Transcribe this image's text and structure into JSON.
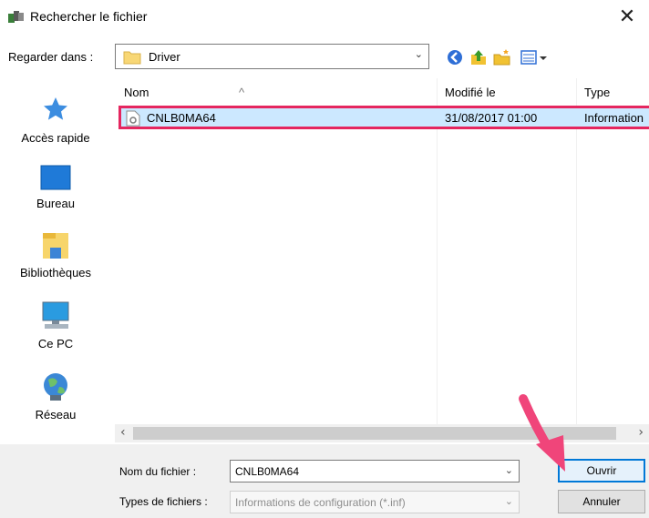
{
  "window": {
    "title": "Rechercher le fichier",
    "close_glyph": "✕"
  },
  "toolbar": {
    "look_in_label": "Regarder dans :",
    "look_in_value": "Driver",
    "buttons": [
      "back-icon",
      "up-folder-icon",
      "new-folder-icon",
      "view-menu-icon"
    ]
  },
  "places": [
    {
      "label": "Accès rapide",
      "icon": "star-icon"
    },
    {
      "label": "Bureau",
      "icon": "desktop-icon"
    },
    {
      "label": "Bibliothèques",
      "icon": "libraries-icon"
    },
    {
      "label": "Ce PC",
      "icon": "computer-icon"
    },
    {
      "label": "Réseau",
      "icon": "network-icon"
    }
  ],
  "file_list": {
    "columns": [
      "Nom",
      "Modifié le",
      "Type"
    ],
    "rows": [
      {
        "name": "CNLB0MA64",
        "modified": "31/08/2017 01:00",
        "type": "Information",
        "selected": true
      }
    ]
  },
  "form": {
    "filename_label": "Nom du fichier :",
    "filename_value": "CNLB0MA64",
    "filetype_label": "Types de fichiers :",
    "filetype_value": "Informations de configuration (*.inf)",
    "open_button": "Ouvrir",
    "cancel_button": "Annuler"
  },
  "colors": {
    "selection": "#cce8ff",
    "highlight_border": "#e5265f",
    "annotation_arrow": "#f0457a",
    "focus": "#0078d7"
  }
}
